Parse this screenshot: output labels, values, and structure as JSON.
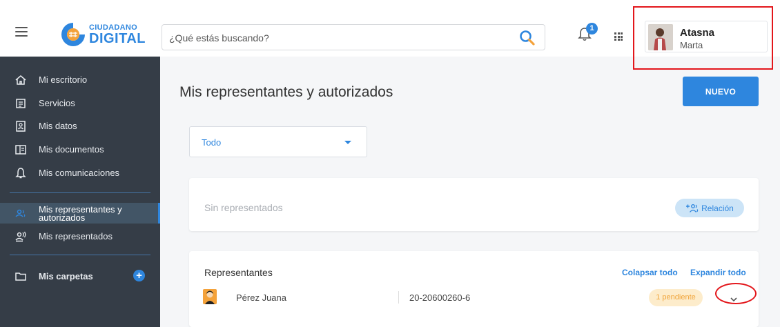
{
  "header": {
    "logo": {
      "line1": "CIUDADANO",
      "line2": "DIGITAL"
    },
    "search": {
      "placeholder": "¿Qué estás buscando?"
    },
    "notifications": {
      "count": "1"
    },
    "user": {
      "name": "Atasna",
      "subtitle": "Marta"
    }
  },
  "sidebar": {
    "items": [
      {
        "label": "Mi escritorio",
        "icon": "home-icon"
      },
      {
        "label": "Servicios",
        "icon": "services-icon"
      },
      {
        "label": "Mis datos",
        "icon": "id-card-icon"
      },
      {
        "label": "Mis documentos",
        "icon": "documents-icon"
      },
      {
        "label": "Mis comunicaciones",
        "icon": "bell-icon"
      }
    ],
    "active_item": {
      "label": "Mis representantes y autorizados",
      "icon": "representatives-icon"
    },
    "represented_item": {
      "label": "Mis representados",
      "icon": "represented-icon"
    },
    "folders": {
      "label": "Mis carpetas",
      "icon": "folder-icon"
    }
  },
  "main": {
    "title": "Mis representantes y autorizados",
    "new_button": "NUEVO",
    "filter": {
      "value": "Todo"
    },
    "represented_card": {
      "empty_text": "Sin representados",
      "relation_button": "Relación"
    },
    "representatives_card": {
      "title": "Representantes",
      "collapse_all": "Colapsar todo",
      "expand_all": "Expandir todo",
      "rows": [
        {
          "name": "Pérez Juana",
          "cuit": "20-20600260-6",
          "status": "1 pendiente"
        }
      ]
    }
  },
  "colors": {
    "accent": "#2e86de",
    "sidebar_bg": "#353d47",
    "annotation": "#e3161b",
    "pending_bg": "#fdeccb",
    "pending_text": "#f0a43a"
  }
}
